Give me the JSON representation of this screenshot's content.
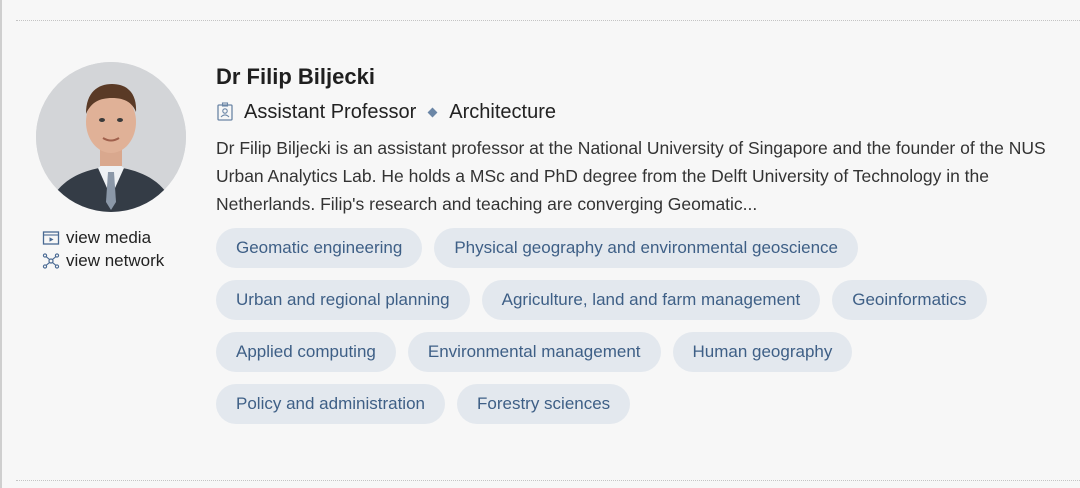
{
  "profile": {
    "name": "Dr Filip Biljecki",
    "role": "Assistant Professor",
    "department": "Architecture",
    "bio": "Dr Filip Biljecki is an assistant professor at the National University of Singapore and the founder of the NUS Urban Analytics Lab. He holds a MSc and PhD degree from the Delft University of Technology in the Netherlands. Filip's research and teaching are converging Geomatic..."
  },
  "links": {
    "view_media": "view media",
    "view_network": "view network"
  },
  "tags": [
    [
      "Geomatic engineering",
      "Physical geography and environmental geoscience"
    ],
    [
      "Urban and regional planning",
      "Agriculture, land and farm management",
      "Geoinformatics"
    ],
    [
      "Applied computing",
      "Environmental management",
      "Human geography"
    ],
    [
      "Policy and administration",
      "Forestry sciences"
    ]
  ],
  "icons": {
    "role": "id-badge-icon",
    "media": "media-play-icon",
    "network": "network-icon"
  },
  "colors": {
    "tag_bg": "#e3e8ee",
    "tag_text": "#3e5f86",
    "accent": "#6b86a6"
  }
}
